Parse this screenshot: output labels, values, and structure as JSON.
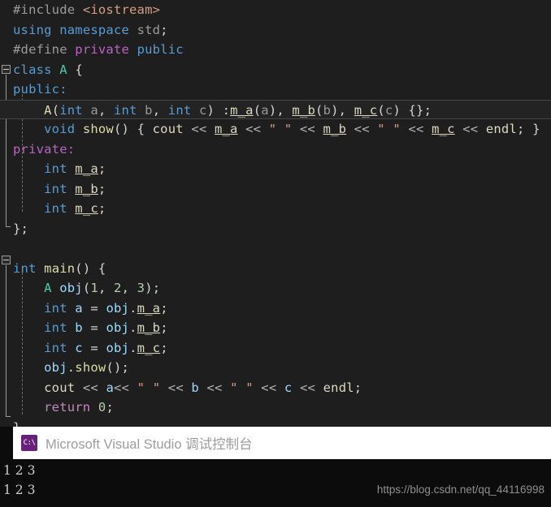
{
  "editor": {
    "background": "#1e1e1e",
    "lines": [
      {
        "id": "line-include",
        "text": "#include <iostream>"
      },
      {
        "id": "line-using",
        "text": "using namespace std;"
      },
      {
        "id": "line-define",
        "text": "#define private public"
      },
      {
        "id": "line-class-a",
        "text": "class A {"
      },
      {
        "id": "line-public",
        "text": "public:"
      },
      {
        "id": "line-ctor",
        "text": "    A(int a, int b, int c) :m_a(a), m_b(b), m_c(c) {};"
      },
      {
        "id": "line-show",
        "text": "    void show() { cout << m_a << \" \" << m_b << \" \" << m_c << endl; }"
      },
      {
        "id": "line-private",
        "text": "private:"
      },
      {
        "id": "line-m-a",
        "text": "    int m_a;"
      },
      {
        "id": "line-m-b",
        "text": "    int m_b;"
      },
      {
        "id": "line-m-c",
        "text": "    int m_c;"
      },
      {
        "id": "line-class-close",
        "text": "};"
      },
      {
        "id": "line-blank",
        "text": ""
      },
      {
        "id": "line-main",
        "text": "int main() {"
      },
      {
        "id": "line-obj",
        "text": "    A obj(1, 2, 3);"
      },
      {
        "id": "line-a",
        "text": "    int a = obj.m_a;"
      },
      {
        "id": "line-b",
        "text": "    int b = obj.m_b;"
      },
      {
        "id": "line-c",
        "text": "    int c = obj.m_c;"
      },
      {
        "id": "line-call-show",
        "text": "    obj.show();"
      },
      {
        "id": "line-cout",
        "text": "    cout << a<< \" \" << b << \" \" << c << endl;"
      },
      {
        "id": "line-return",
        "text": "    return 0;"
      },
      {
        "id": "line-main-close",
        "text": "}"
      }
    ],
    "tokens": {
      "include_directive": "#include",
      "include_header": "<iostream>",
      "using": "using",
      "namespace": "namespace",
      "std": "std",
      "define_directive": "#define",
      "macro_from": "private",
      "macro_to": "public",
      "kw_class": "class",
      "type_a": "A",
      "brace_open": "{",
      "brace_close": "}",
      "access_public": "public:",
      "access_private": "private:",
      "kw_int": "int",
      "kw_void": "void",
      "kw_return": "return",
      "fn_show": "show",
      "fn_main": "main",
      "id_obj": "obj",
      "id_a": "a",
      "id_b": "b",
      "id_c": "c",
      "mem_m_a": "m_a",
      "mem_m_b": "m_b",
      "mem_m_c": "m_c",
      "stream_cout": "cout",
      "stream_endl": "endl",
      "op_shift": "<<",
      "str_space": "\" \"",
      "num_0": "0",
      "num_1": "1",
      "num_2": "2",
      "num_3": "3"
    },
    "colors": {
      "keyword": "#569cd6",
      "type": "#4ec9b0",
      "function": "#dcdcaa",
      "variable": "#9cdcfe",
      "string": "#d69d85",
      "number": "#b5cea8",
      "macro": "#bd63c5",
      "control": "#c586c0",
      "preprocessor": "#9b9b9b",
      "stream": "#dadac0",
      "punctuation": "#d4d4d4"
    }
  },
  "console": {
    "icon_name": "cmd-console-icon",
    "icon_label": "C:\\",
    "icon_color": "#68217a",
    "title": "Microsoft Visual Studio 调试控制台",
    "output_lines": [
      "1 2 3",
      "1 2 3"
    ]
  },
  "watermark": {
    "text": "https://blog.csdn.net/qq_44116998"
  }
}
